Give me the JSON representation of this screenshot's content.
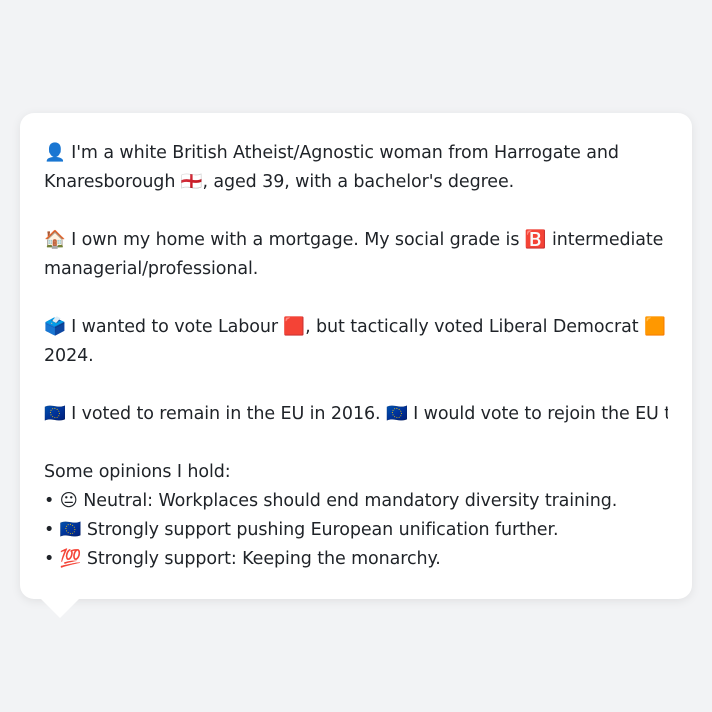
{
  "profile": {
    "identity": {
      "icon": "person-silhouette-icon",
      "line1": "👤 I'm a white British Atheist/Agnostic woman from Harrogate and",
      "line2": "Knaresborough 🏴󠁧󠁢󠁥󠁮󠁧󠁿, aged 39, with a bachelor's degree."
    },
    "home": {
      "icon": "house-icon",
      "line1": "🏠 I own my home with a mortgage. My social grade is 🅱️ intermediate",
      "line2": "managerial/professional."
    },
    "vote": {
      "icon": "ballot-box-icon",
      "line1": "🗳️ I wanted to vote Labour 🟥, but tactically voted Liberal Democrat 🟧 in",
      "line2": "2024."
    },
    "eu": {
      "icon": "eu-flag-icon",
      "line1": "🇪🇺 I voted to remain in the EU in 2016. 🇪🇺 I would vote to rejoin the EU today."
    },
    "opinions": {
      "heading": "Some opinions I hold:",
      "items": [
        "• 😐 Neutral: Workplaces should end mandatory diversity training.",
        "• 🇪🇺 Strongly support pushing European unification further.",
        "• 💯 Strongly support: Keeping the monarchy."
      ]
    }
  },
  "colors": {
    "background": "#f2f3f5",
    "bubble": "#ffffff",
    "text": "#1f2328"
  }
}
